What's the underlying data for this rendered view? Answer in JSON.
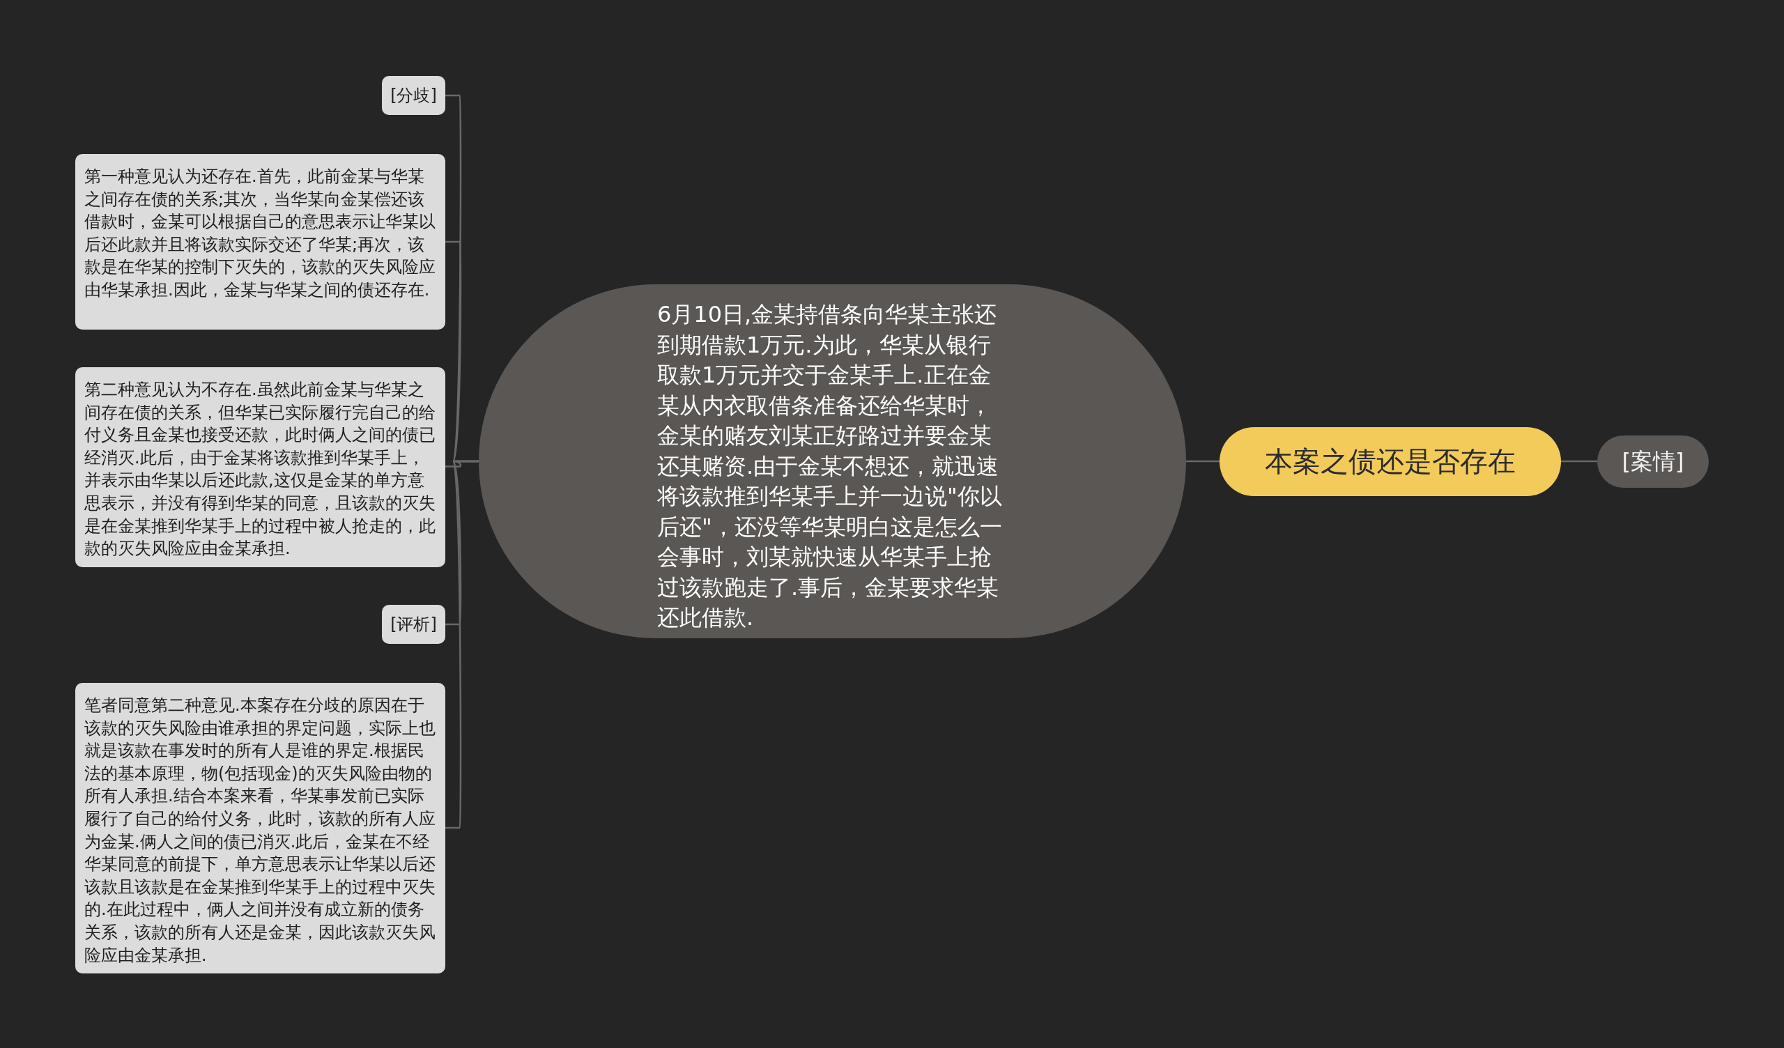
{
  "mind_map": {
    "root": {
      "text": "本案之债还是否存在"
    },
    "case_label": {
      "text": "[案情]"
    },
    "case_text": {
      "text": "6月10日,金某持借条向华某主张还到期借款1万元.为此，华某从银行取款1万元并交于金某手上.正在金某从内衣取借条准备还给华某时，金某的赌友刘某正好路过并要金某还其赌资.由于金某不想还，就迅速将该款推到华某手上并一边说\"你以后还\"，还没等华某明白这是怎么一会事时，刘某就快速从华某手上抢过该款跑走了.事后，金某要求华某还此借款."
    },
    "branches": [
      {
        "kind": "label",
        "text": "[分歧]"
      },
      {
        "kind": "card",
        "text": "第一种意见认为还存在.首先，此前金某与华某之间存在债的关系;其次，当华某向金某偿还该借款时，金某可以根据自己的意思表示让华某以后还此款并且将该款实际交还了华某;再次，该款是在华某的控制下灭失的，该款的灭失风险应由华某承担.因此，金某与华某之间的债还存在."
      },
      {
        "kind": "card",
        "text": "第二种意见认为不存在.虽然此前金某与华某之间存在债的关系，但华某已实际履行完自己的给付义务且金某也接受还款，此时俩人之间的债已经消灭.此后，由于金某将该款推到华某手上，并表示由华某以后还此款,这仅是金某的单方意思表示，并没有得到华某的同意，且该款的灭失是在金某推到华某手上的过程中被人抢走的，此款的灭失风险应由金某承担."
      },
      {
        "kind": "label",
        "text": "[评析]"
      },
      {
        "kind": "card",
        "text": "笔者同意第二种意见.本案存在分歧的原因在于该款的灭失风险由谁承担的界定问题，实际上也就是该款在事发时的所有人是谁的界定.根据民法的基本原理，物(包括现金)的灭失风险由物的所有人承担.结合本案来看，华某事发前已实际履行了自己的给付义务，此时，该款的所有人应为金某.俩人之间的债已消灭.此后，金某在不经华某同意的前提下，单方意思表示让华某以后还该款且该款是在金某推到华某手上的过程中灭失的.在此过程中，俩人之间并没有成立新的债务关系，该款的所有人还是金某，因此该款灭失风险应由金某承担."
      }
    ]
  }
}
